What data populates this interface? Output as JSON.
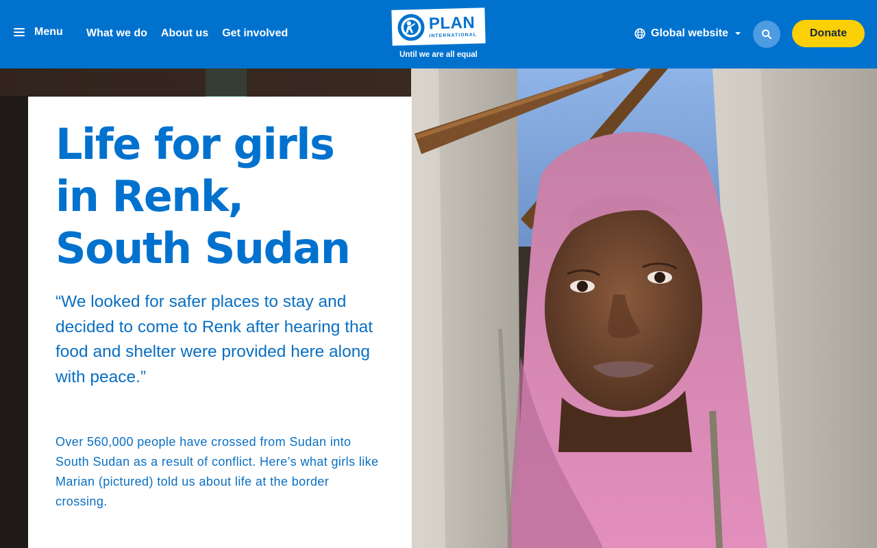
{
  "header": {
    "menu_label": "Menu",
    "nav": [
      "What we do",
      "About us",
      "Get involved"
    ],
    "logo": {
      "name": "PLAN",
      "sub": "INTERNATIONAL",
      "tagline": "Until we are all equal"
    },
    "global_label": "Global website",
    "donate_label": "Donate"
  },
  "hero": {
    "title": "Life for girls in Renk, South Sudan",
    "quote": "“We looked for safer places to stay and decided to come to Renk after hearing that food and shelter were provided here along with peace.”",
    "body": "Over 560,000 people have crossed from Sudan into South Sudan as a result of conflict. Here’s what girls like Marian (pictured) told us about life at the border crossing."
  },
  "colors": {
    "brand_blue": "#0072ce",
    "donate_yellow": "#fbd007",
    "search_circle": "#4d9be0",
    "text_blue": "#0a6fc2"
  },
  "icons": [
    "hamburger-icon",
    "globe-icon",
    "chevron-down-icon",
    "search-icon",
    "plan-logo-icon"
  ]
}
